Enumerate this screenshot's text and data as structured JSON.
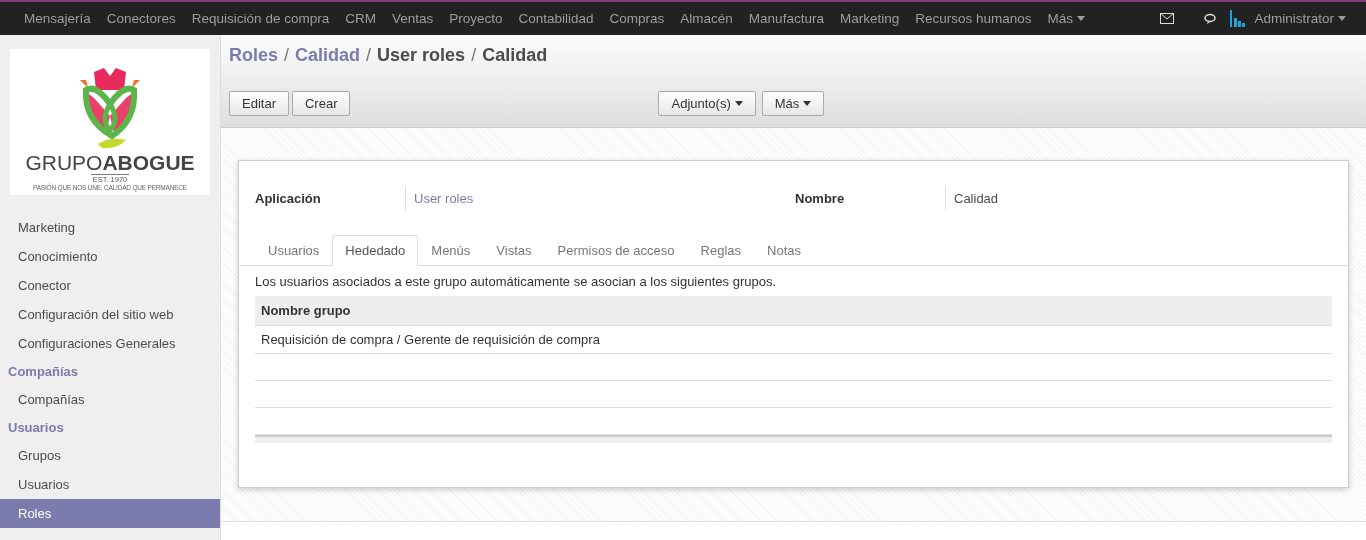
{
  "menu": {
    "items": [
      "Mensajería",
      "Conectores",
      "Requisición de compra",
      "CRM",
      "Ventas",
      "Proyecto",
      "Contabilidad",
      "Compras",
      "Almacén",
      "Manufactura",
      "Marketing",
      "Recursos humanos"
    ],
    "more": "Más",
    "user": "Administrator"
  },
  "logo": {
    "brand_light": "GRUPO",
    "brand_bold": "ABOGUE",
    "est": "EST. 1970",
    "tagline": "PASIÓN QUE NOS UNE, CALIDAD QUE PERMANECE"
  },
  "sidebar": {
    "sections": [
      {
        "items": [
          {
            "label": "Marketing",
            "selected": false
          },
          {
            "label": "Conocimiento",
            "selected": false
          },
          {
            "label": "Conector",
            "selected": false
          },
          {
            "label": "Configuración del sitio web",
            "selected": false
          },
          {
            "label": "Configuraciones Generales",
            "selected": false
          }
        ]
      },
      {
        "header": "Compañías",
        "items": [
          {
            "label": "Compañías",
            "selected": false
          }
        ]
      },
      {
        "header": "Usuarios",
        "items": [
          {
            "label": "Grupos",
            "selected": false
          },
          {
            "label": "Usuarios",
            "selected": false
          },
          {
            "label": "Roles",
            "selected": true
          }
        ]
      }
    ]
  },
  "breadcrumbs": [
    {
      "label": "Roles",
      "link": true
    },
    {
      "separator": "/",
      "label": "Calidad",
      "link": true
    },
    {
      "separator": "/",
      "label": "User roles",
      "link": false
    },
    {
      "separator": "/",
      "label": "Calidad",
      "link": false
    }
  ],
  "buttons": {
    "left": [
      "Editar",
      "Crear"
    ],
    "dropdowns": [
      "Adjunto(s)",
      "Más"
    ]
  },
  "form": {
    "fields": [
      {
        "label": "Aplicación",
        "value": "User roles",
        "link": true
      },
      {
        "label": "Nombre",
        "value": "Calidad",
        "link": false
      }
    ],
    "tabs": [
      {
        "label": "Usuarios",
        "selected": false
      },
      {
        "label": "Hededado",
        "selected": true
      },
      {
        "label": "Menús",
        "selected": false
      },
      {
        "label": "Vistas",
        "selected": false
      },
      {
        "label": "Permisos de acceso",
        "selected": false
      },
      {
        "label": "Reglas",
        "selected": false
      },
      {
        "label": "Notas",
        "selected": false
      }
    ],
    "description": "Los usuarios asociados a este grupo automáticamente se asocian a los siguientes grupos.",
    "table": {
      "columns": [
        "Nombre grupo"
      ],
      "rows": [
        [
          "Requisición de compra / Gerente de requisición de compra"
        ]
      ]
    }
  }
}
